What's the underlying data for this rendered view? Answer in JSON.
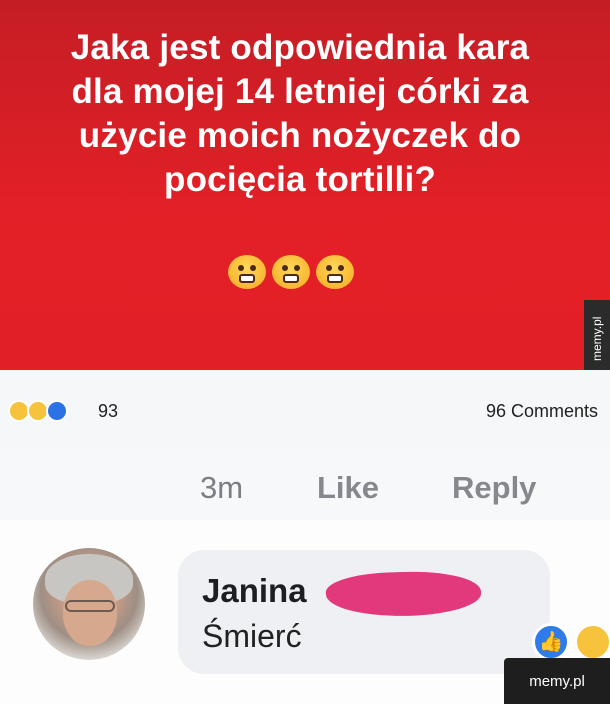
{
  "post": {
    "text": "Jaka jest odpowiednia kara\ndla mojej 14 letniej córki za\nużycie moich nożyczek do\npocięcia tortilli?",
    "emojis": [
      "grimacing-face",
      "grimacing-face",
      "grimacing-face"
    ],
    "background_color": "#e01f26"
  },
  "reactions": {
    "icons": [
      "haha-reaction-icon",
      "wow-reaction-icon",
      "like-reaction-icon"
    ],
    "count": "93",
    "comments": "96 Comments"
  },
  "actions": {
    "time": "3m",
    "like": "Like",
    "reply": "Reply"
  },
  "comment": {
    "author": "Janina",
    "text": "Śmierć",
    "reactions": [
      "like-reaction-icon",
      "haha-reaction-icon"
    ]
  },
  "watermarks": {
    "side": "memy.pl",
    "corner": "memy.pl"
  }
}
